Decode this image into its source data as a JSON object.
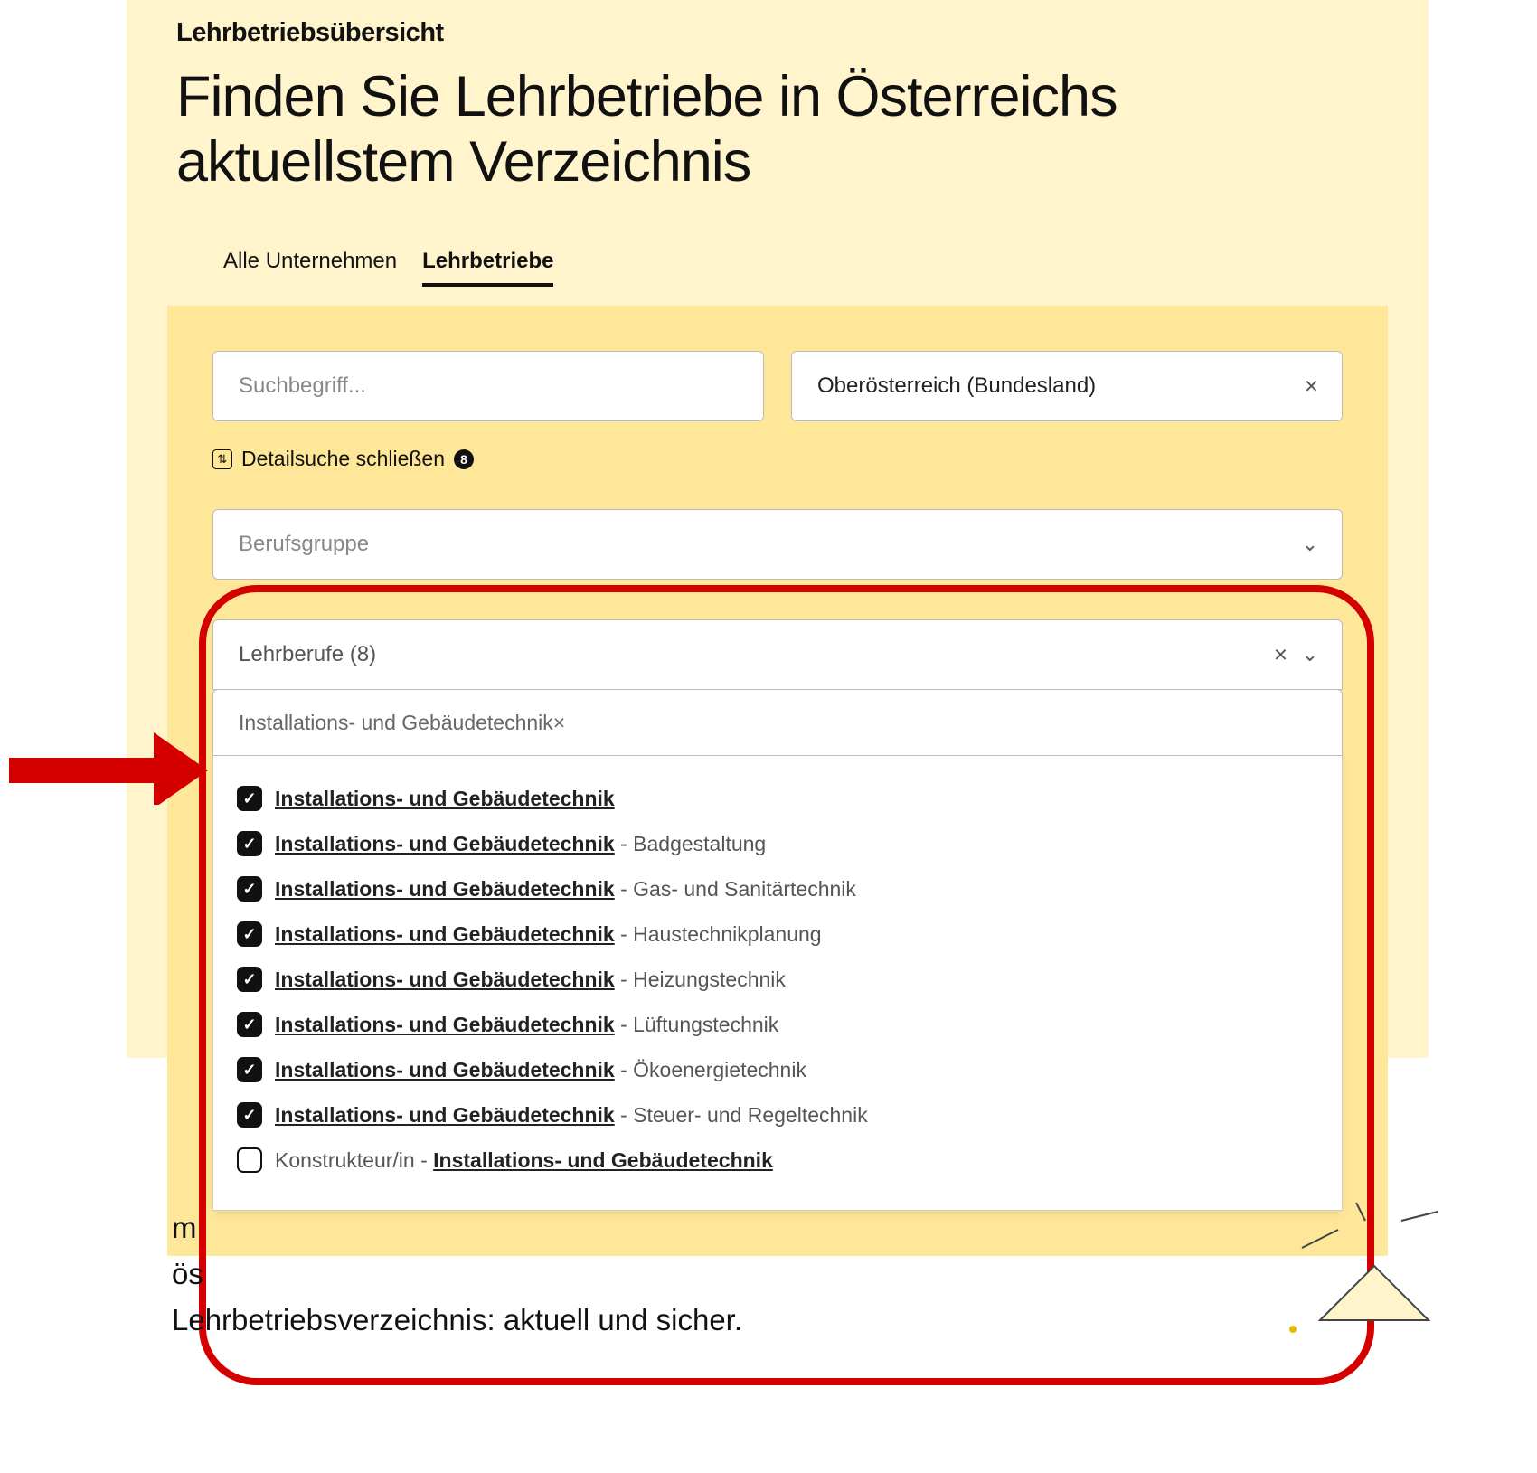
{
  "header": {
    "overline": "Lehrbetriebsübersicht",
    "headline": "Finden Sie Lehrbetriebe in Österreichs aktuellstem Verzeichnis"
  },
  "tabs": {
    "all": "Alle Unternehmen",
    "train": "Lehrbetriebe",
    "active": "train"
  },
  "search": {
    "term_placeholder": "Suchbegriff...",
    "region_value": "Oberösterreich (Bundesland)",
    "detail_text": "Detailsuche schließen",
    "detail_badge": "8",
    "berufsgruppe_placeholder": "Berufsgruppe",
    "lehrberufe_label": "Lehrberufe (8)",
    "filter_value": "Installations- und Gebäudetechnik"
  },
  "options": [
    {
      "checked": true,
      "highlight": "Installations- und Gebäudetechnik",
      "suffix": ""
    },
    {
      "checked": true,
      "highlight": "Installations- und Gebäudetechnik",
      "suffix": " - Badgestaltung"
    },
    {
      "checked": true,
      "highlight": "Installations- und Gebäudetechnik",
      "suffix": " - Gas- und Sanitärtechnik"
    },
    {
      "checked": true,
      "highlight": "Installations- und Gebäudetechnik",
      "suffix": " - Haustechnikplanung"
    },
    {
      "checked": true,
      "highlight": "Installations- und Gebäudetechnik",
      "suffix": " - Heizungstechnik"
    },
    {
      "checked": true,
      "highlight": "Installations- und Gebäudetechnik",
      "suffix": " - Lüftungstechnik"
    },
    {
      "checked": true,
      "highlight": "Installations- und Gebäudetechnik",
      "suffix": " - Ökoenergietechnik"
    },
    {
      "checked": true,
      "highlight": "Installations- und Gebäudetechnik",
      "suffix": " - Steuer- und Regeltechnik"
    },
    {
      "checked": false,
      "prefix": "Konstrukteur/in - ",
      "highlight": "Installations- und Gebäudetechnik",
      "suffix": ""
    }
  ],
  "footer": {
    "line1_fragment": "m",
    "line2_fragment": "ös",
    "line3": "Lehrbetriebsverzeichnis: aktuell und sicher."
  },
  "annotation": {
    "color": "#d40000"
  }
}
